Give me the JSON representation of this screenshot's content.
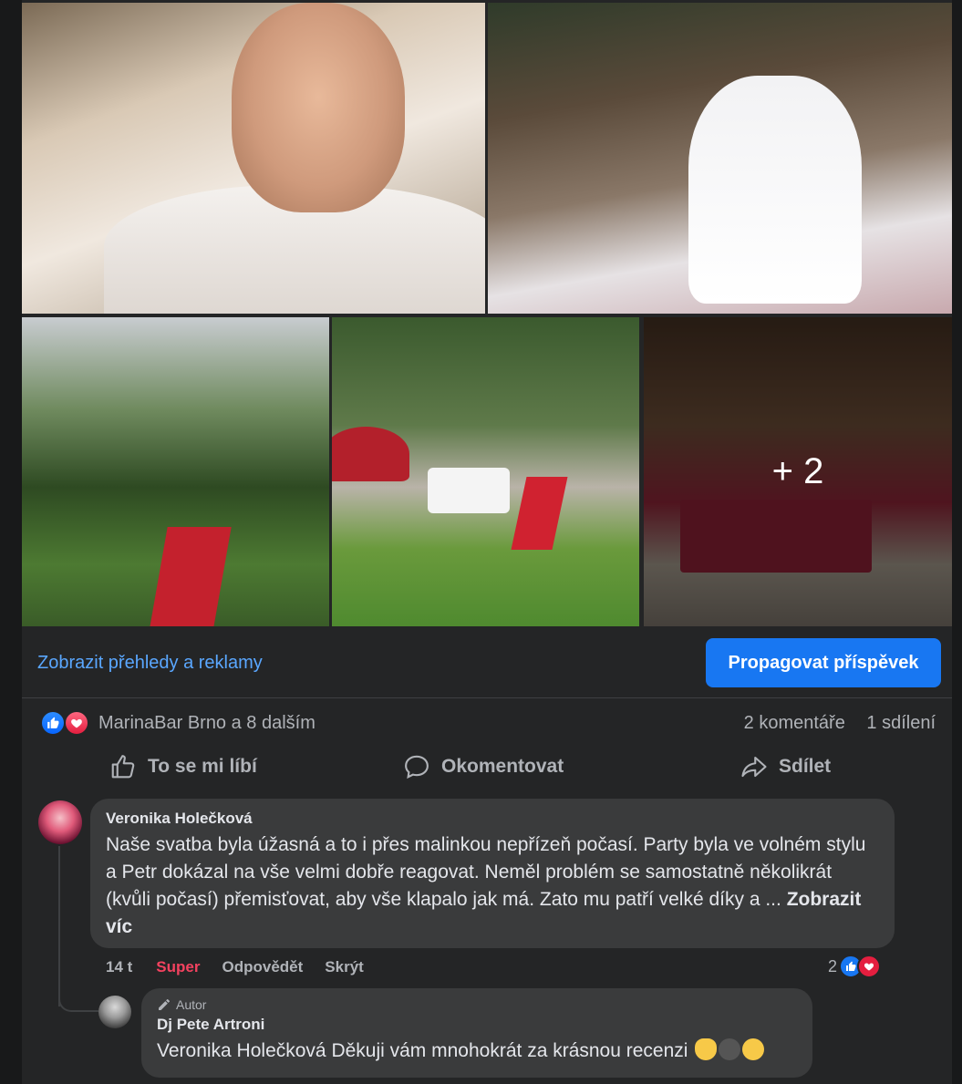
{
  "photo_grid": {
    "more_count": "+ 2"
  },
  "insights": {
    "link_label": "Zobrazit přehledy a reklamy",
    "promote_label": "Propagovat příspěvek"
  },
  "reactions": {
    "names": "MarinaBar Brno a 8 dalším",
    "comments": "2 komentáře",
    "shares": "1 sdílení",
    "icons": [
      "like-icon",
      "love-icon"
    ]
  },
  "actions": {
    "like": "To se mi líbí",
    "comment": "Okomentovat",
    "share": "Sdílet"
  },
  "comments": [
    {
      "author": "Veronika Holečková",
      "text": "Naše svatba byla úžasná a to i přes malinkou nepřízeň počasí. Party byla ve volném stylu a Petr dokázal na vše velmi dobře reagovat. Neměl problém se samostatně několikrát (kvůli počasí) přemisťovat, aby vše klapalo jak má. Zato mu patří velké díky a ...",
      "more_label": "Zobrazit víc",
      "time": "14 t",
      "reaction_label": "Super",
      "reply_label": "Odpovědět",
      "hide_label": "Skrýt",
      "reaction_count": "2"
    }
  ],
  "reply": {
    "badge": "Autor",
    "author": "Dj Pete Artroni",
    "text": "Veronika Holečková Děkuji vám mnohokrát za krásnou recenzi"
  },
  "colors": {
    "accent": "#1877f2",
    "link": "#5aa7ff",
    "super": "#f3425f",
    "background": "#242526",
    "bubble": "#3a3b3c"
  }
}
